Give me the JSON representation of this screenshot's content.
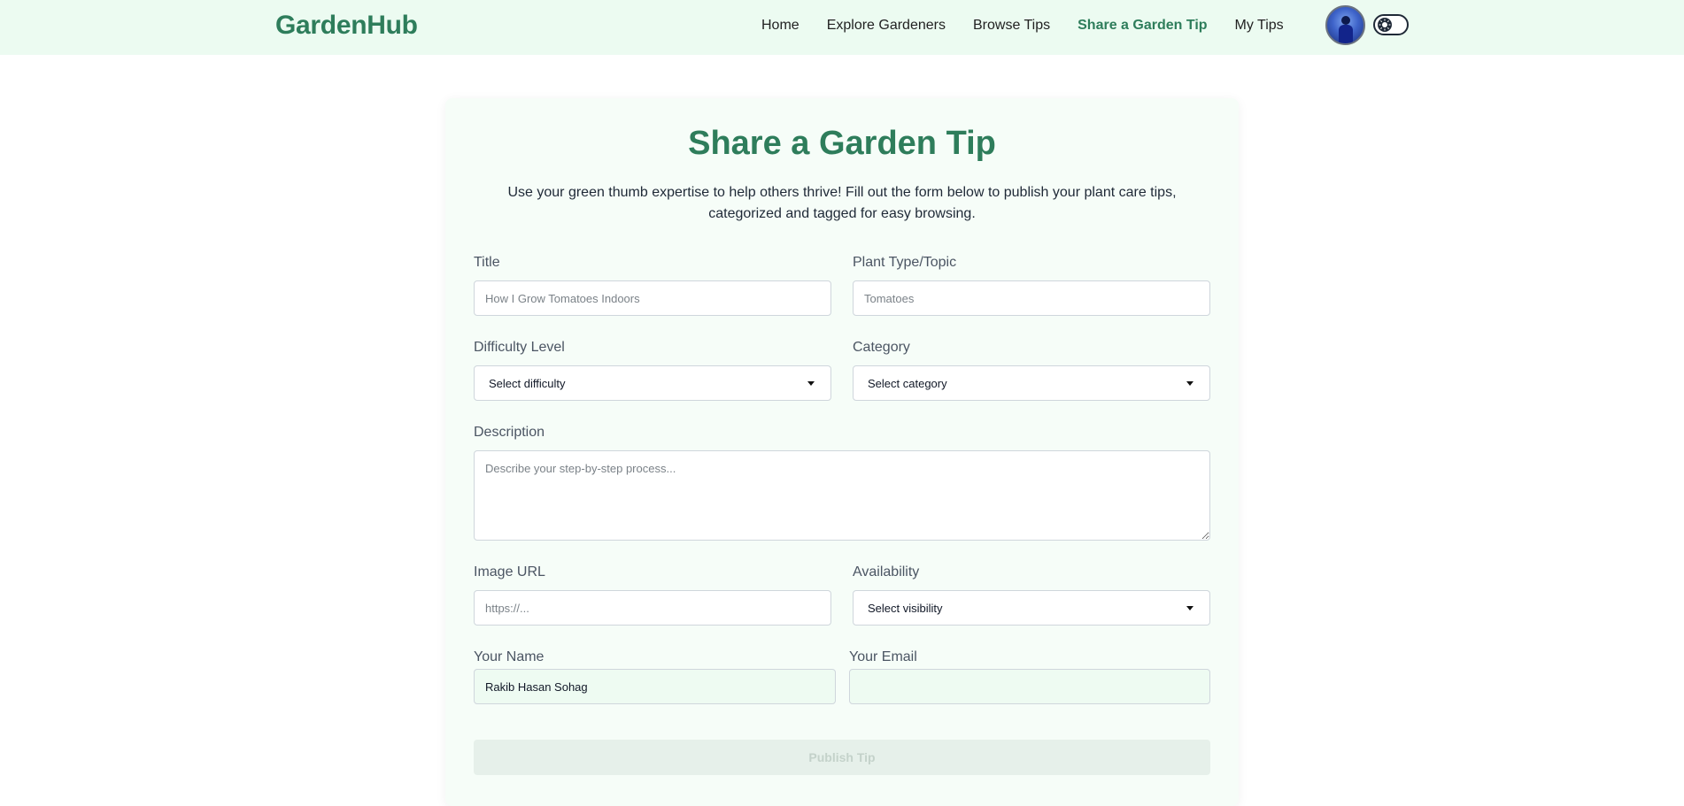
{
  "header": {
    "brand": "GardenHub",
    "nav": [
      {
        "label": "Home"
      },
      {
        "label": "Explore Gardeners"
      },
      {
        "label": "Browse Tips"
      },
      {
        "label": "Share a Garden Tip"
      },
      {
        "label": "My Tips"
      }
    ],
    "active_nav": "Share a Garden Tip",
    "avatar_icon": "user-avatar",
    "theme_toggle_icon": "theme-toggle-icon"
  },
  "form": {
    "title": "Share a Garden Tip",
    "subtitle": "Use your green thumb expertise to help others thrive! Fill out the form below to publish your plant care tips, categorized and tagged for easy browsing.",
    "title_field": {
      "label": "Title",
      "placeholder": "How I Grow Tomatoes Indoors",
      "value": ""
    },
    "plant_field": {
      "label": "Plant Type/Topic",
      "placeholder": "Tomatoes",
      "value": ""
    },
    "difficulty_field": {
      "label": "Difficulty Level",
      "selected": "Select difficulty"
    },
    "category_field": {
      "label": "Category",
      "selected": "Select category"
    },
    "description_field": {
      "label": "Description",
      "placeholder": "Describe your step-by-step process...",
      "value": ""
    },
    "image_field": {
      "label": "Image URL",
      "placeholder": "https://...",
      "value": ""
    },
    "availability_field": {
      "label": "Availability",
      "selected": "Select visibility"
    },
    "name_field": {
      "label": "Your Name",
      "value": "Rakib Hasan Sohag"
    },
    "email_field": {
      "label": "Your Email",
      "value": ""
    },
    "publish_label": "Publish Tip"
  },
  "colors": {
    "brand": "#2e7d5b",
    "header_bg": "#ecfbf1",
    "card_bg": "#f6fdf8"
  }
}
